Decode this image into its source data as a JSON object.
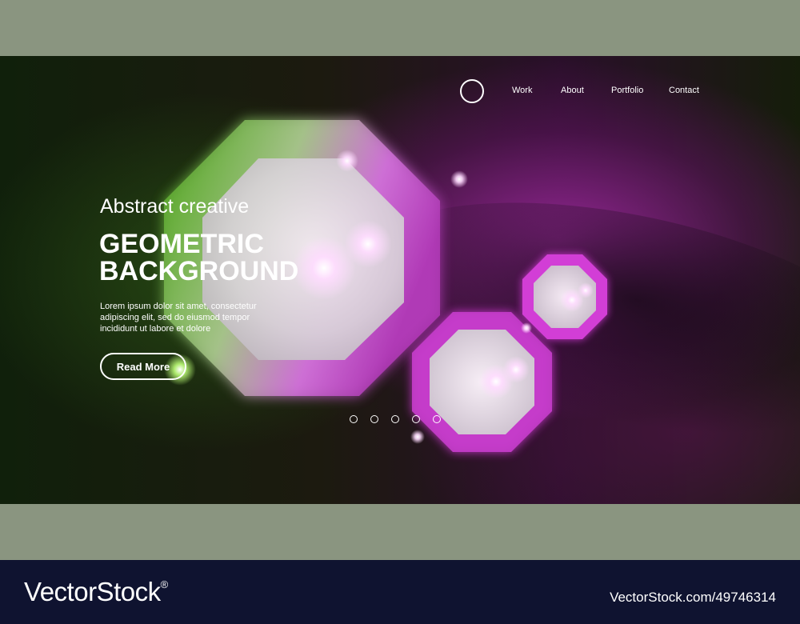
{
  "nav": {
    "items": [
      "Work",
      "About",
      "Portfolio",
      "Contact"
    ]
  },
  "hero": {
    "subtitle": "Abstract creative",
    "title_line1": "GEOMETRIC",
    "title_line2": "BACKGROUND",
    "body": "Lorem ipsum dolor sit amet, consectetur adipiscing elit, sed do eiusmod tempor incididunt ut labore et dolore",
    "cta_label": "Read More",
    "pagination_count": 5
  },
  "footer": {
    "brand": "VectorStock",
    "brand_mark": "®",
    "stock_id": "VectorStock.com/49746314"
  },
  "colors": {
    "green_glow": "#5fd11f",
    "magenta_glow": "#e23be6",
    "footer_bg": "#0f1330",
    "frame_bg": "#8a9580"
  }
}
